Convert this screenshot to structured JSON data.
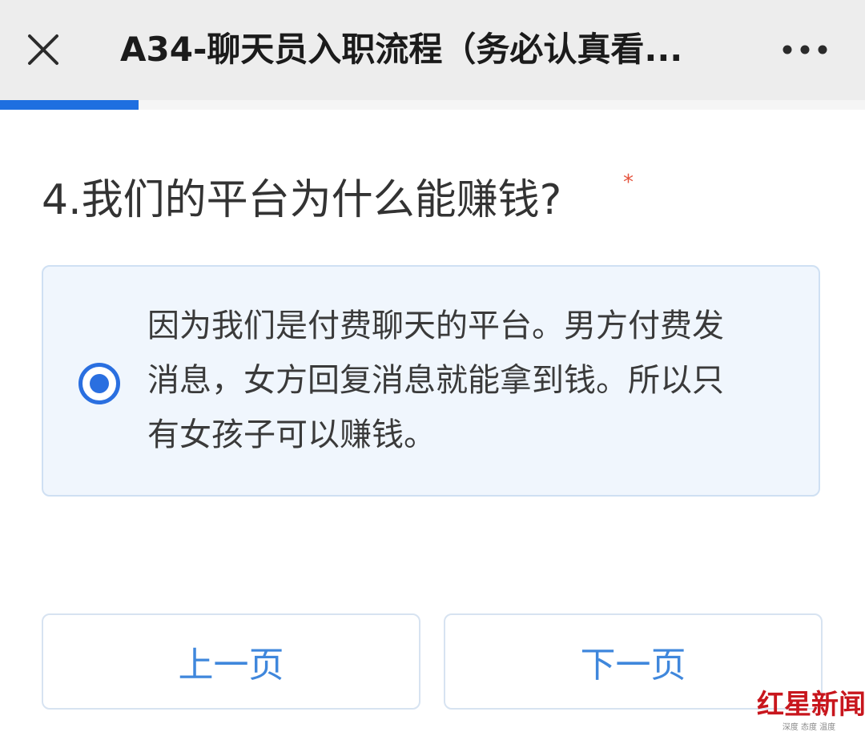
{
  "header": {
    "close_icon": "close-icon",
    "title": "A34-聊天员入职流程（务必认真看...",
    "more_icon": "more-horizontal-icon"
  },
  "progress": {
    "fraction": 0.16,
    "color": "#1e6fe0"
  },
  "question": {
    "text": "4.我们的平台为什么能赚钱?",
    "required_mark": "*"
  },
  "option": {
    "selected": true,
    "text": "因为我们是付费聊天的平台。男方付费发消息，女方回复消息就能拿到钱。所以只有女孩子可以赚钱。"
  },
  "nav": {
    "prev_label": "上一页",
    "next_label": "下一页"
  },
  "watermark": {
    "logo_text": "红星新闻",
    "tagline": "深度 态度 温度"
  },
  "colors": {
    "accent": "#2a6fe0",
    "button_text": "#3f87dc",
    "required": "#e5533d",
    "watermark": "#c8161d"
  }
}
